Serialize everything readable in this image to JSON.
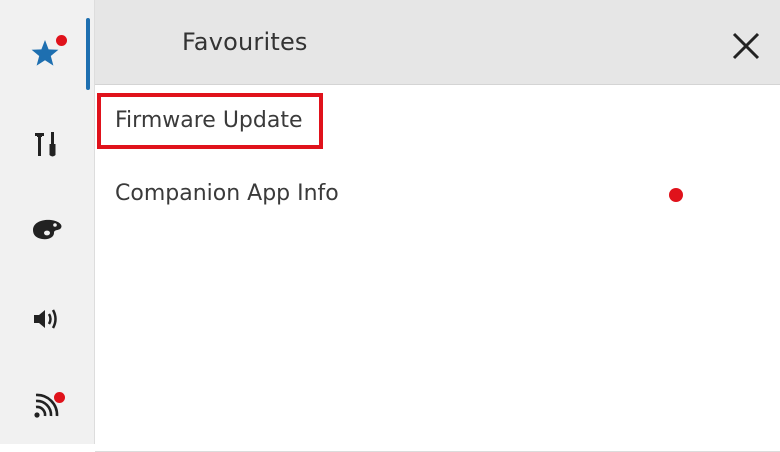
{
  "header": {
    "title": "Favourites"
  },
  "sidebar": {
    "items": [
      {
        "icon": "star-icon",
        "active": true,
        "badge": true
      },
      {
        "icon": "tools-icon",
        "active": false,
        "badge": false
      },
      {
        "icon": "palette-icon",
        "active": false,
        "badge": false
      },
      {
        "icon": "speaker-icon",
        "active": false,
        "badge": false
      },
      {
        "icon": "signal-icon",
        "active": false,
        "badge": true
      }
    ]
  },
  "list": {
    "items": [
      {
        "label": "Firmware Update",
        "highlighted": true,
        "badge": false
      },
      {
        "label": "Companion App Info",
        "highlighted": false,
        "badge": true
      },
      {
        "label": "",
        "highlighted": false,
        "badge": false
      },
      {
        "label": "",
        "highlighted": false,
        "badge": false
      },
      {
        "label": "",
        "highlighted": false,
        "badge": false
      }
    ]
  },
  "colors": {
    "accent_blue": "#1e6fb0",
    "badge_red": "#e0121b",
    "highlight_red": "#e0121b",
    "header_bg": "#e6e6e6",
    "sidebar_bg": "#f1f1f1"
  }
}
